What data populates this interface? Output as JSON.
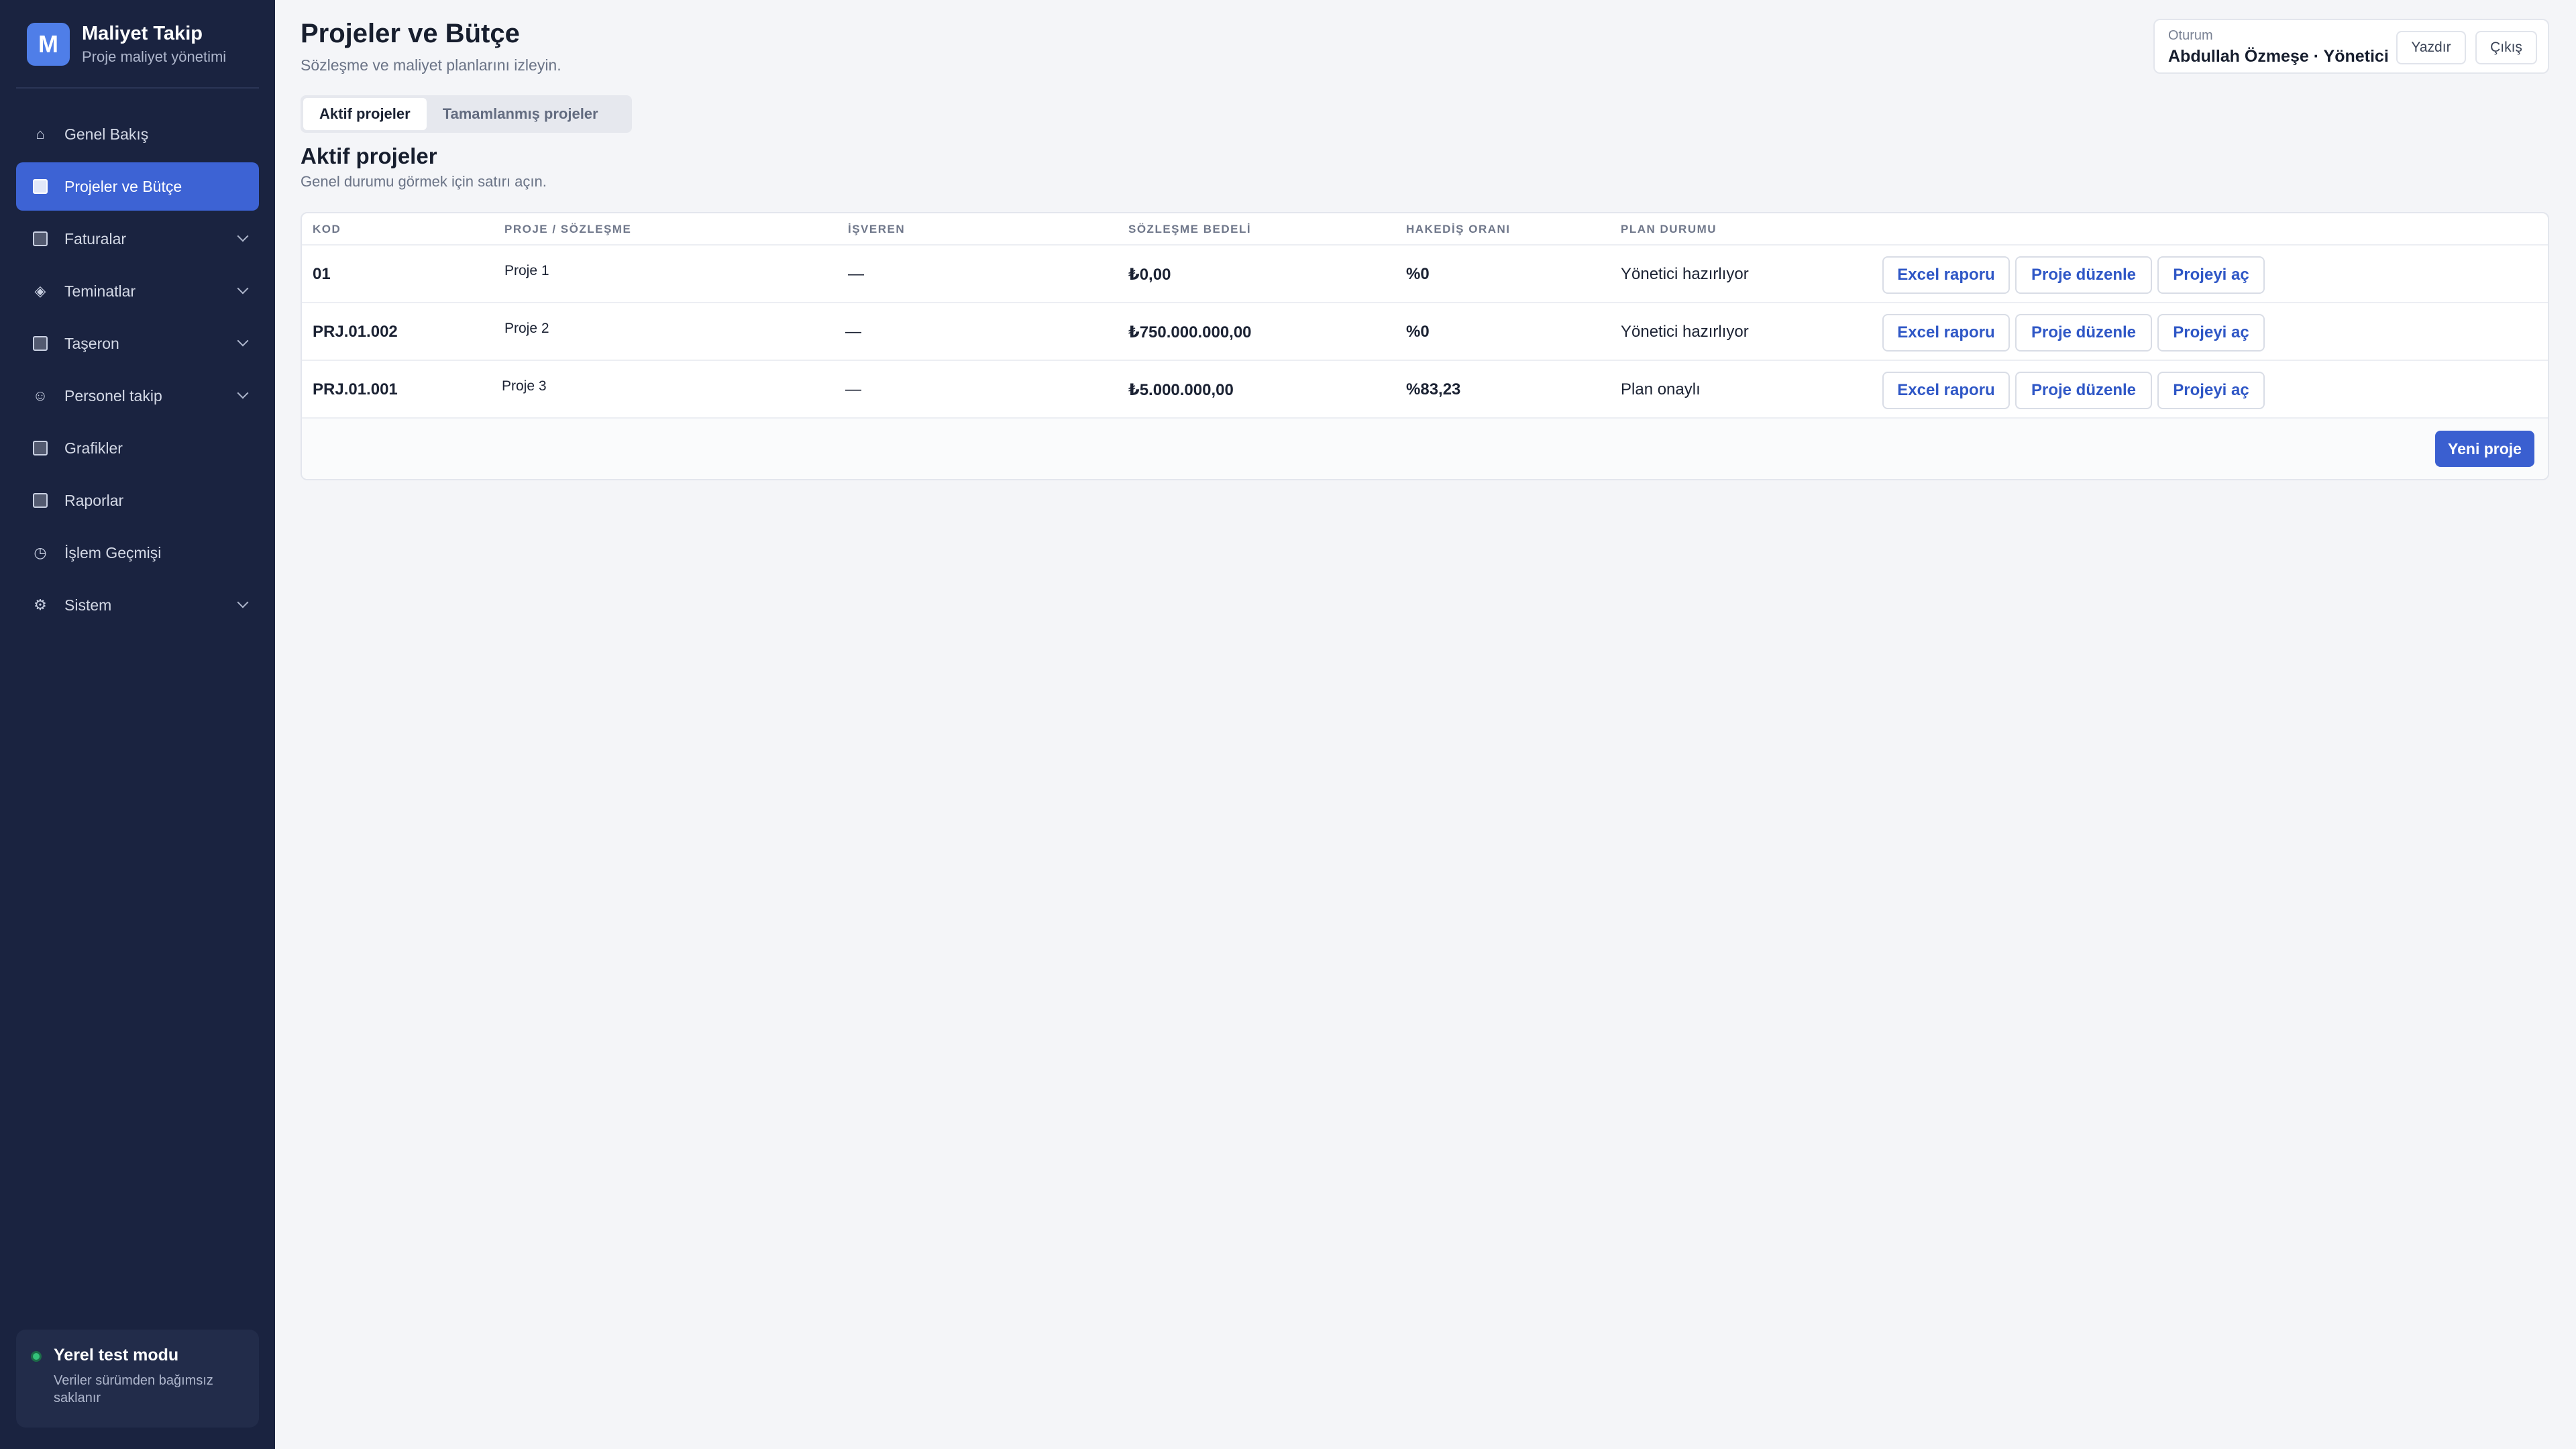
{
  "brand": {
    "logo_letter": "M",
    "title": "Maliyet Takip",
    "subtitle": "Proje maliyet yönetimi"
  },
  "sidebar": {
    "items": [
      {
        "label": "Genel Bakış",
        "icon": "home-icon",
        "active": false,
        "expandable": false
      },
      {
        "label": "Projeler ve Bütçe",
        "icon": "square-icon",
        "active": true,
        "expandable": false
      },
      {
        "label": "Faturalar",
        "icon": "square-icon",
        "active": false,
        "expandable": true
      },
      {
        "label": "Teminatlar",
        "icon": "diamond-icon",
        "active": false,
        "expandable": true
      },
      {
        "label": "Taşeron",
        "icon": "square-icon",
        "active": false,
        "expandable": true
      },
      {
        "label": "Personel takip",
        "icon": "smiley-icon",
        "active": false,
        "expandable": true
      },
      {
        "label": "Grafikler",
        "icon": "square-icon",
        "active": false,
        "expandable": false
      },
      {
        "label": "Raporlar",
        "icon": "square-icon",
        "active": false,
        "expandable": false
      },
      {
        "label": "İşlem Geçmişi",
        "icon": "clock-icon",
        "active": false,
        "expandable": false
      },
      {
        "label": "Sistem",
        "icon": "gear-icon",
        "active": false,
        "expandable": true
      }
    ],
    "test_mode": {
      "title": "Yerel test modu",
      "description": "Veriler sürümden bağımsız saklanır",
      "status_color": "#34c27a"
    }
  },
  "header": {
    "title": "Projeler ve Bütçe",
    "subtitle": "Sözleşme ve maliyet planlarını izleyin."
  },
  "session": {
    "label": "Oturum",
    "user": "Abdullah Özmeşe · Yönetici",
    "print_label": "Yazdır",
    "logout_label": "Çıkış"
  },
  "tabs": [
    {
      "label": "Aktif projeler",
      "active": true
    },
    {
      "label": "Tamamlanmış projeler",
      "active": false
    }
  ],
  "section": {
    "title": "Aktif projeler",
    "subtitle": "Genel durumu görmek için satırı açın."
  },
  "table": {
    "columns": [
      "KOD",
      "PROJE / SÖZLEŞME",
      "İŞVEREN",
      "SÖZLEŞME BEDELİ",
      "HAKEDİŞ ORANI",
      "PLAN DURUMU"
    ],
    "rows": [
      {
        "code": "01",
        "project": "Proje 1",
        "employer": "—",
        "amount": "₺0,00",
        "rate": "%0",
        "status": "Yönetici hazırlıyor"
      },
      {
        "code": "PRJ.01.002",
        "project": "Proje 2",
        "employer": "—",
        "amount": "₺750.000.000,00",
        "rate": "%0",
        "status": "Yönetici hazırlıyor"
      },
      {
        "code": "PRJ.01.001",
        "project": "Proje 3",
        "employer": "—",
        "amount": "₺5.000.000,00",
        "rate": "%83,23",
        "status": "Plan onaylı"
      }
    ],
    "row_actions": {
      "excel": "Excel raporu",
      "edit": "Proje düzenle",
      "open": "Projeyi aç"
    },
    "new_button": "Yeni proje"
  },
  "colors": {
    "sidebar_bg": "#1a2340",
    "accent": "#3d63d4",
    "link": "#2f57c6"
  }
}
